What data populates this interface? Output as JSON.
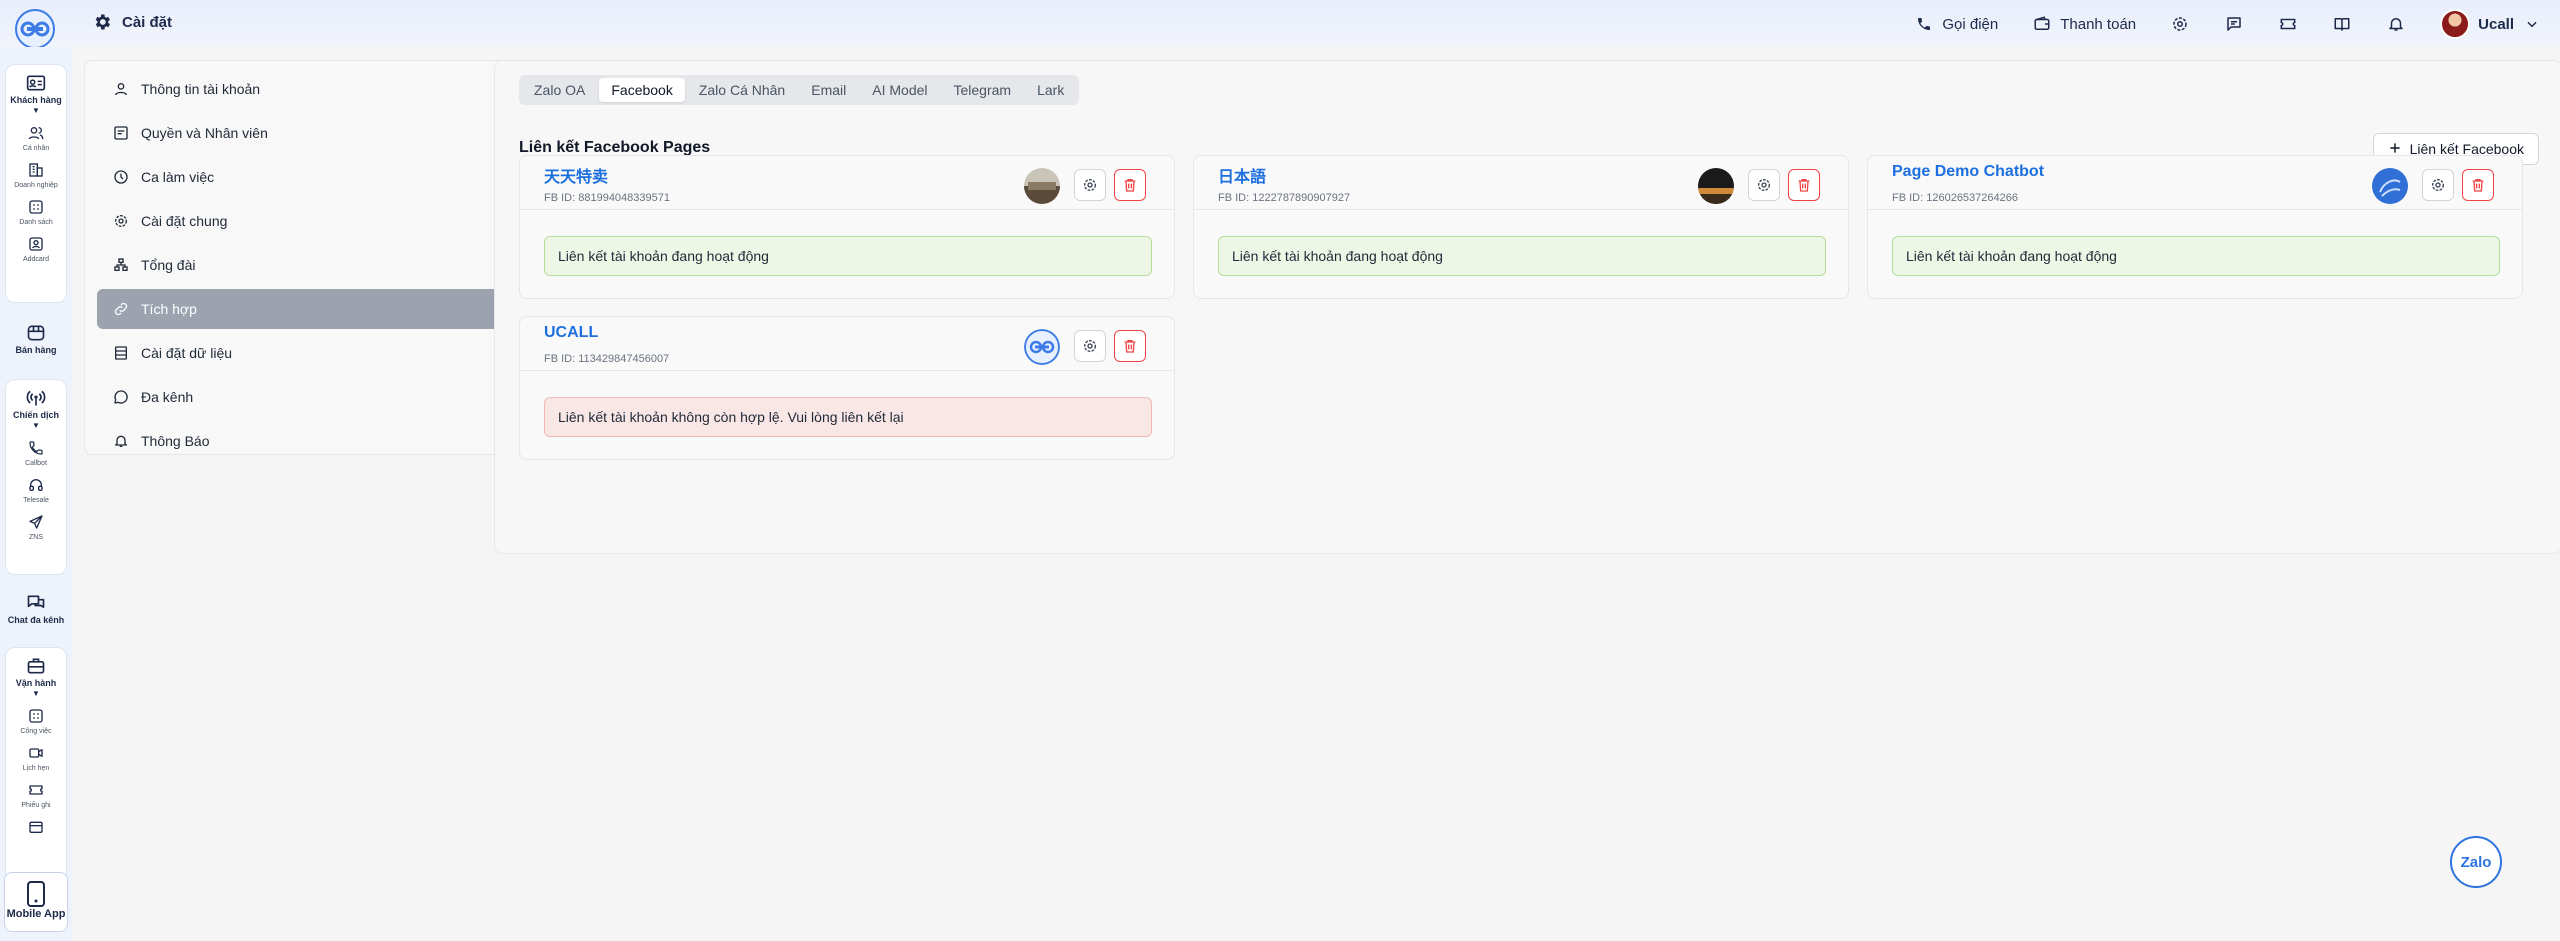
{
  "header": {
    "title": "Cài đặt",
    "call_label": "Gọi điện",
    "payment_label": "Thanh toán",
    "user_name": "Ucall"
  },
  "rail": {
    "customers": {
      "label": "Khách hàng",
      "items": [
        "Cá nhân",
        "Doanh nghiệp",
        "Danh sách",
        "Addcard"
      ]
    },
    "sales": {
      "label": "Bán hàng"
    },
    "campaigns": {
      "label": "Chiến dịch",
      "items": [
        "Callbot",
        "Telesale",
        "ZNS"
      ]
    },
    "omni_chat": {
      "label": "Chat đa kênh"
    },
    "operations": {
      "label": "Vận hành",
      "items": [
        "Công việc",
        "Lịch hẹn",
        "Phiếu ghi"
      ]
    },
    "mobile_app": {
      "label": "Mobile App"
    }
  },
  "settings_menu": {
    "items": [
      {
        "label": "Thông tin tài khoản",
        "icon": "user-icon",
        "expandable": true
      },
      {
        "label": "Quyền và Nhân viên",
        "icon": "id-card-icon",
        "expandable": true
      },
      {
        "label": "Ca làm việc",
        "icon": "clock-icon",
        "expandable": false
      },
      {
        "label": "Cài đặt chung",
        "icon": "gear-icon",
        "expandable": true
      },
      {
        "label": "Tổng đài",
        "icon": "switchboard-icon",
        "expandable": true
      },
      {
        "label": "Tích hợp",
        "icon": "link-icon",
        "expandable": false,
        "active": true
      },
      {
        "label": "Cài đặt dữ liệu",
        "icon": "database-icon",
        "expandable": true
      },
      {
        "label": "Đa kênh",
        "icon": "chat-icon",
        "expandable": false
      },
      {
        "label": "Thông Báo",
        "icon": "bell-icon",
        "expandable": false
      }
    ]
  },
  "tabs": [
    "Zalo OA",
    "Facebook",
    "Zalo Cá Nhân",
    "Email",
    "AI Model",
    "Telegram",
    "Lark"
  ],
  "active_tab": "Facebook",
  "section": {
    "title": "Liên kết Facebook Pages",
    "add_button": "Liên kết Facebook"
  },
  "pages": [
    {
      "name": "天天特卖",
      "fb_id": "FB ID: 881994048339571",
      "status": "Liên kết tài khoản đang hoạt động",
      "ok": true
    },
    {
      "name": "日本語",
      "fb_id": "FB ID: 1222787890907927",
      "status": "Liên kết tài khoản đang hoạt động",
      "ok": true
    },
    {
      "name": "Page Demo Chatbot",
      "fb_id": "FB ID: 126026537264266",
      "status": "Liên kết tài khoản đang hoạt động",
      "ok": true
    },
    {
      "name": "UCALL",
      "fb_id": "FB ID: 113429847456007",
      "status": "Liên kết tài khoản không còn hợp lệ. Vui lòng liên kết lại",
      "ok": false
    }
  ],
  "zalo_widget": {
    "label": "Zalo"
  },
  "colors": {
    "accent": "#1d6fe0",
    "danger": "#ef4444",
    "active_menu": "#9ca3af",
    "status_ok_bg": "#eef6e6",
    "status_bad_bg": "#f9e7e6"
  }
}
